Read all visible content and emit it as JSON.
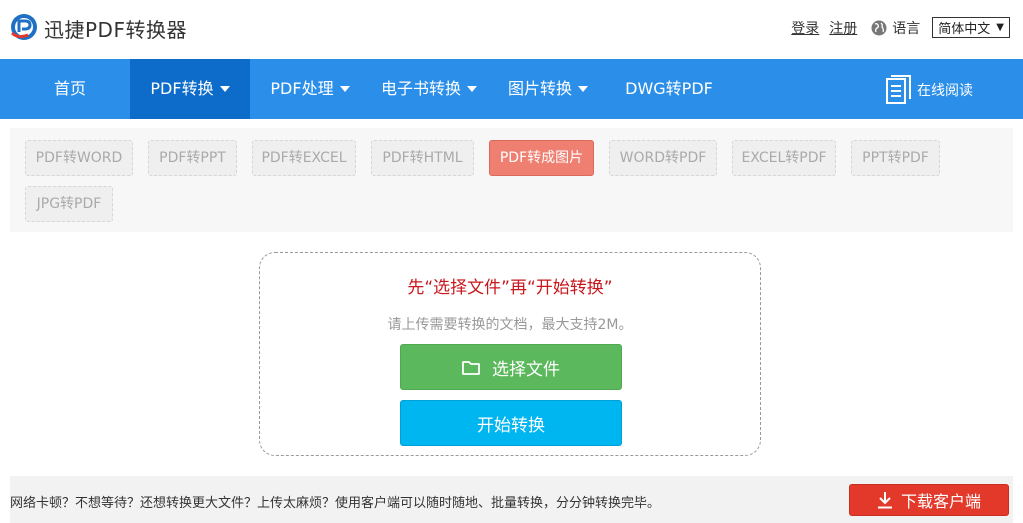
{
  "header": {
    "brand": "迅捷PDF转换器",
    "login": "登录",
    "register": "注册",
    "language_label": "语言",
    "language_value": "简体中文",
    "language_arrow": "▼"
  },
  "nav": {
    "items": [
      {
        "label": "首页",
        "dropdown": false
      },
      {
        "label": "PDF转换",
        "dropdown": true,
        "active": true
      },
      {
        "label": "PDF处理",
        "dropdown": true
      },
      {
        "label": "电子书转换",
        "dropdown": true
      },
      {
        "label": "图片转换",
        "dropdown": true
      },
      {
        "label": "DWG转PDF",
        "dropdown": false
      }
    ],
    "online_read": "在线阅读"
  },
  "tabs": [
    {
      "label": "PDF转WORD"
    },
    {
      "label": "PDF转PPT"
    },
    {
      "label": "PDF转EXCEL"
    },
    {
      "label": "PDF转HTML"
    },
    {
      "label": "PDF转成图片",
      "active": true
    },
    {
      "label": "WORD转PDF"
    },
    {
      "label": "EXCEL转PDF"
    },
    {
      "label": "PPT转PDF"
    },
    {
      "label": "JPG转PDF"
    }
  ],
  "upload": {
    "headline": "先“选择文件”再“开始转换”",
    "hint": "请上传需要转换的文档，最大支持2M。",
    "select_label": "选择文件",
    "start_label": "开始转换"
  },
  "footer": {
    "text": "网络卡顿？不想等待？还想转换更大文件？上传太麻烦？使用客户端可以随时随地、批量转换，分分钟转换完毕。",
    "download_label": "下载客户端"
  },
  "colors": {
    "nav_blue": "#2b8fe9",
    "nav_active": "#0d6cc9",
    "tab_active": "#ef7f71",
    "headline_red": "#c8171d",
    "select_green": "#5cb85c",
    "start_blue": "#00b6f1",
    "download_red": "#e2392b"
  }
}
